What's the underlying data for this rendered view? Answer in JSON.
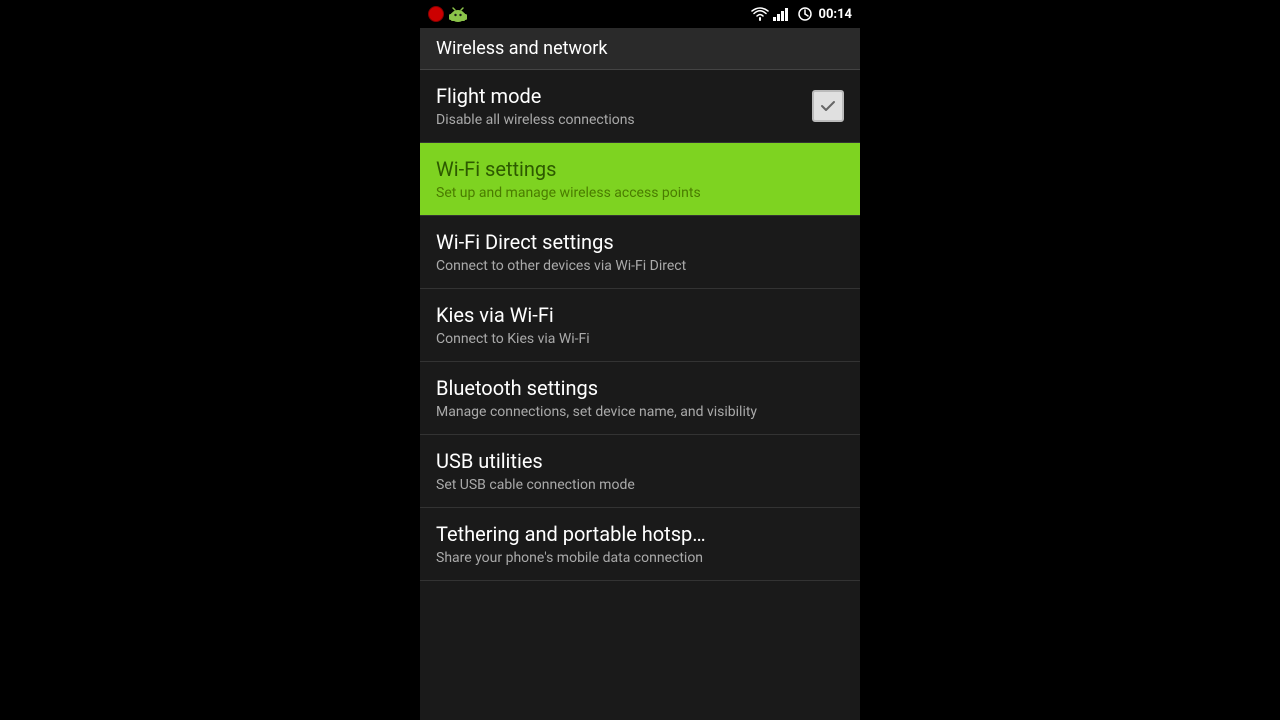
{
  "statusBar": {
    "time": "00:14",
    "leftIcons": [
      "recording",
      "android"
    ]
  },
  "header": {
    "title": "Wireless and network"
  },
  "settings": {
    "items": [
      {
        "id": "flight-mode",
        "title": "Flight mode",
        "subtitle": "Disable all wireless connections",
        "hasCheckbox": true,
        "checked": false,
        "highlighted": false
      },
      {
        "id": "wifi-settings",
        "title": "Wi-Fi settings",
        "subtitle": "Set up and manage wireless access points",
        "hasCheckbox": false,
        "highlighted": true
      },
      {
        "id": "wifi-direct",
        "title": "Wi-Fi Direct settings",
        "subtitle": "Connect to other devices via Wi-Fi Direct",
        "hasCheckbox": false,
        "highlighted": false
      },
      {
        "id": "kies-wifi",
        "title": "Kies via Wi-Fi",
        "subtitle": "Connect to Kies via Wi-Fi",
        "hasCheckbox": false,
        "highlighted": false
      },
      {
        "id": "bluetooth",
        "title": "Bluetooth settings",
        "subtitle": "Manage connections, set device name, and visibility",
        "hasCheckbox": false,
        "highlighted": false
      },
      {
        "id": "usb-utilities",
        "title": "USB utilities",
        "subtitle": "Set USB cable connection mode",
        "hasCheckbox": false,
        "highlighted": false
      },
      {
        "id": "tethering",
        "title": "Tethering and portable hotsp…",
        "subtitle": "Share your phone's mobile data connection",
        "hasCheckbox": false,
        "highlighted": false
      }
    ]
  }
}
